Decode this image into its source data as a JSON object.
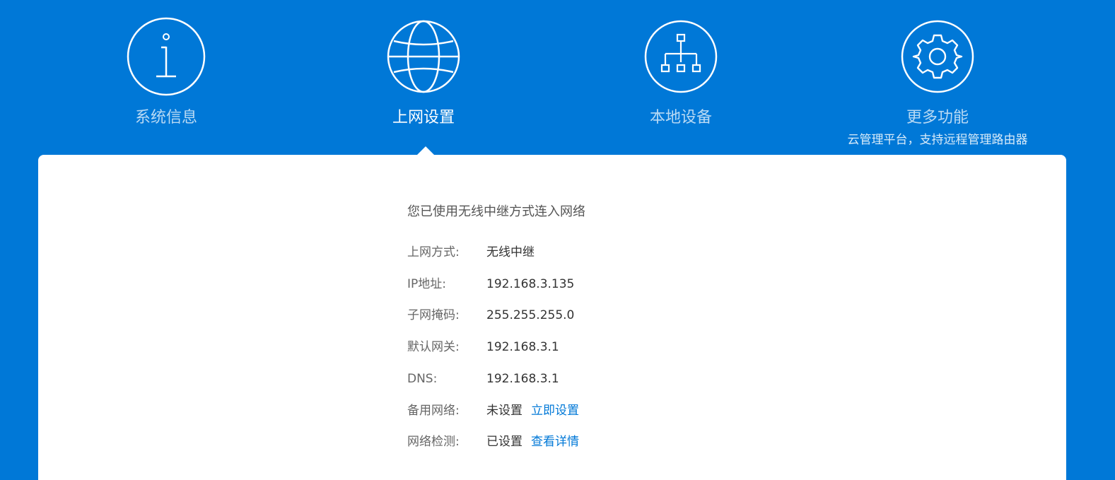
{
  "nav": {
    "items": [
      {
        "label": "系统信息",
        "icon": "info-icon"
      },
      {
        "label": "上网设置",
        "icon": "globe-icon",
        "active": true
      },
      {
        "label": "本地设备",
        "icon": "network-topology-icon"
      },
      {
        "label": "更多功能",
        "icon": "gear-icon",
        "subtitle": "云管理平台，支持远程管理路由器"
      }
    ]
  },
  "main": {
    "status": "您已使用无线中继方式连入网络",
    "rows": [
      {
        "label": "上网方式:",
        "value": "无线中继"
      },
      {
        "label": "IP地址:",
        "value": "192.168.3.135"
      },
      {
        "label": "子网掩码:",
        "value": "255.255.255.0"
      },
      {
        "label": "默认网关:",
        "value": "192.168.3.1"
      },
      {
        "label": "DNS:",
        "value": "192.168.3.1"
      },
      {
        "label": "备用网络:",
        "value": "未设置",
        "link": "立即设置"
      },
      {
        "label": "网络检测:",
        "value": "已设置",
        "link": "查看详情"
      }
    ]
  },
  "colors": {
    "background": "#0078D7",
    "panel": "#FFFFFF",
    "link": "#0078D7"
  }
}
